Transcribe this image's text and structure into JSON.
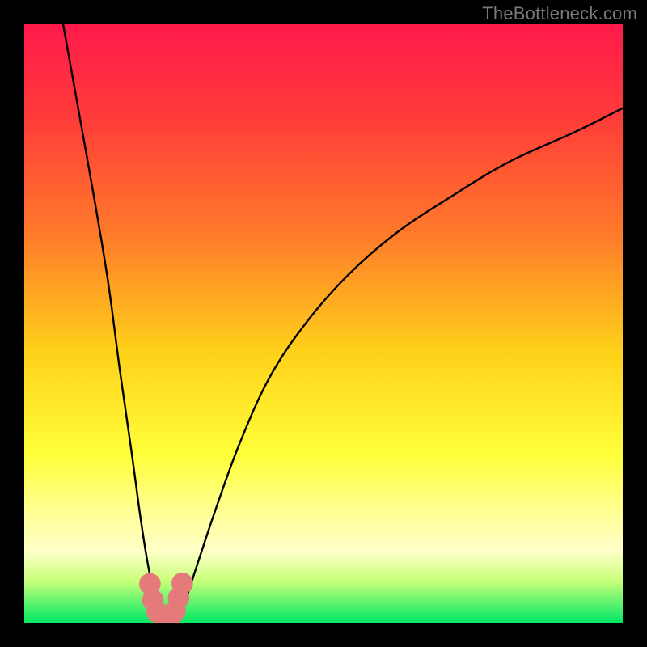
{
  "watermark": "TheBottleneck.com",
  "chart_data": {
    "type": "line",
    "title": "",
    "xlabel": "",
    "ylabel": "",
    "xlim": [
      0,
      100
    ],
    "ylim": [
      0,
      100
    ],
    "gradient_stops": [
      {
        "offset": 0,
        "color": "#ff1a4b"
      },
      {
        "offset": 15,
        "color": "#ff3a3a"
      },
      {
        "offset": 35,
        "color": "#ff7a2a"
      },
      {
        "offset": 55,
        "color": "#ffd21a"
      },
      {
        "offset": 72,
        "color": "#ffff3a"
      },
      {
        "offset": 82,
        "color": "#ffff99"
      },
      {
        "offset": 88,
        "color": "#ffffc8"
      },
      {
        "offset": 93,
        "color": "#c8ff7a"
      },
      {
        "offset": 100,
        "color": "#00e865"
      }
    ],
    "series": [
      {
        "name": "left-branch",
        "x": [
          6.5,
          9,
          11.5,
          14,
          16,
          18,
          19.5,
          20.8,
          22,
          22.8
        ],
        "y": [
          100,
          86,
          72,
          57,
          42,
          28,
          17,
          9,
          4,
          1
        ]
      },
      {
        "name": "right-branch",
        "x": [
          25.5,
          27,
          29,
          32,
          36,
          41,
          47,
          54,
          62,
          71,
          81,
          92,
          100
        ],
        "y": [
          1,
          4,
          10,
          19,
          30,
          41,
          50,
          58,
          65,
          71,
          77,
          82,
          86
        ]
      }
    ],
    "markers": {
      "name": "salmon-dots",
      "color": "#e57a7a",
      "points": [
        {
          "x": 21.0,
          "y": 6.5,
          "r": 1.8
        },
        {
          "x": 21.5,
          "y": 3.8,
          "r": 1.8
        },
        {
          "x": 22.2,
          "y": 1.8,
          "r": 1.8
        },
        {
          "x": 23.2,
          "y": 0.9,
          "r": 1.8
        },
        {
          "x": 24.4,
          "y": 0.9,
          "r": 1.8
        },
        {
          "x": 25.2,
          "y": 2.0,
          "r": 1.8
        },
        {
          "x": 25.8,
          "y": 4.2,
          "r": 1.8
        },
        {
          "x": 26.4,
          "y": 6.6,
          "r": 1.8
        }
      ]
    }
  }
}
